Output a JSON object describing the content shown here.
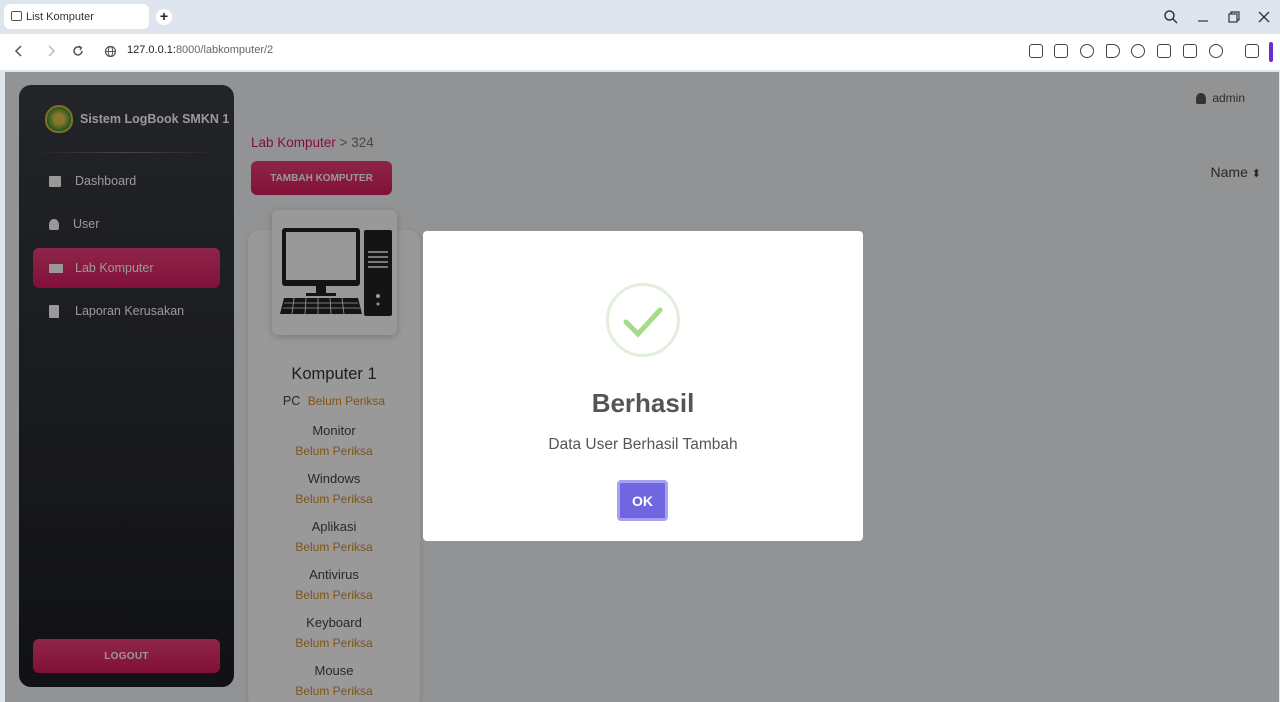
{
  "browser": {
    "tab_title": "List Komputer",
    "new_tab": "+",
    "url_host": "127.0.0.1:",
    "url_path": "8000/labkomputer/2"
  },
  "sidebar": {
    "brand": "Sistem LogBook SMKN 1",
    "items": [
      {
        "label": "Dashboard",
        "icon": "dashboard-icon",
        "active": false
      },
      {
        "label": "User",
        "icon": "user-icon",
        "active": false
      },
      {
        "label": "Lab Komputer",
        "icon": "laptop-icon",
        "active": true
      },
      {
        "label": "Laporan Kerusakan",
        "icon": "book-icon",
        "active": false
      }
    ],
    "logout": "LOGOUT"
  },
  "header": {
    "user": "admin"
  },
  "breadcrumb": {
    "parent": "Lab Komputer",
    "separator": ">",
    "current": "324"
  },
  "toolbar": {
    "add_label": "TAMBAH KOMPUTER",
    "sort_label": "Name",
    "sort_icon": "⬍"
  },
  "card": {
    "title": "Komputer 1",
    "pc_label": "PC",
    "pc_status": "Belum Periksa",
    "rows": [
      {
        "label": "Monitor",
        "status": "Belum Periksa"
      },
      {
        "label": "Windows",
        "status": "Belum Periksa"
      },
      {
        "label": "Aplikasi",
        "status": "Belum Periksa"
      },
      {
        "label": "Antivirus",
        "status": "Belum Periksa"
      },
      {
        "label": "Keyboard",
        "status": "Belum Periksa"
      },
      {
        "label": "Mouse",
        "status": "Belum Periksa"
      }
    ]
  },
  "modal": {
    "title": "Berhasil",
    "message": "Data User Berhasil Tambah",
    "ok": "OK"
  },
  "colors": {
    "accent": "#d81b60",
    "status": "#d98b1f",
    "confirm": "#7066e0",
    "success": "#a5dc86"
  }
}
